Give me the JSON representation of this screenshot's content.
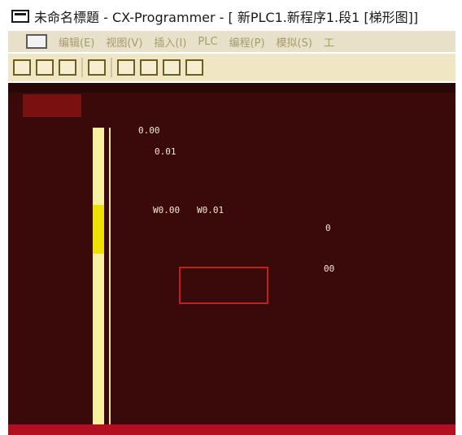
{
  "window": {
    "title": "未命名標題 - CX-Programmer - [ 新PLC1.新程序1.段1 [梯形图]]"
  },
  "menubar": {
    "items": [
      "编辑(E)",
      "视图(V)",
      "插入(I)",
      "PLC",
      "编程(P)",
      "模拟(S)",
      "工"
    ]
  },
  "icons": {
    "app": "app-window-icon",
    "toolbar": [
      "new-icon",
      "open-icon",
      "save-icon",
      "print-icon",
      "cut-icon",
      "copy-icon",
      "paste-icon",
      "find-icon"
    ]
  },
  "ladder": {
    "rung_labels": [
      "0",
      "00"
    ],
    "contacts": [
      "0.00",
      "0.01",
      "W0.00",
      "W0.01"
    ]
  },
  "colors": {
    "workspace_bg": "#3a0a0a",
    "rail_yellow": "#f7f0a0",
    "selection_red": "#c02020",
    "title_bg": "#ffffff",
    "menubar_bg": "#e8e0c8"
  }
}
